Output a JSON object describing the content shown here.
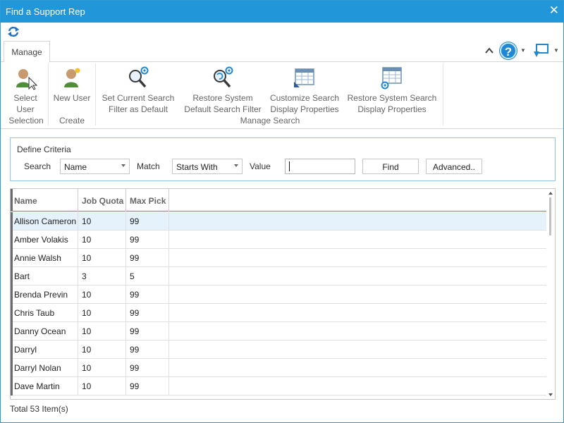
{
  "window": {
    "title": "Find a Support Rep"
  },
  "ribbon": {
    "tab": "Manage",
    "buttons": {
      "select_user": [
        "Select",
        "User"
      ],
      "new_user": [
        "New User"
      ],
      "set_default": [
        "Set Current Search",
        "Filter as Default"
      ],
      "restore_default": [
        "Restore System",
        "Default Search Filter"
      ],
      "customize_display": [
        "Customize Search",
        "Display Properties"
      ],
      "restore_display": [
        "Restore System Search",
        "Display Properties"
      ]
    },
    "groups": {
      "selection": "Selection",
      "create": "Create",
      "manage_search": "Manage Search"
    }
  },
  "criteria": {
    "legend": "Define Criteria",
    "search_label": "Search",
    "search_value": "Name",
    "match_label": "Match",
    "match_value": "Starts With",
    "value_label": "Value",
    "value_text": "",
    "find_label": "Find",
    "advanced_label": "Advanced.."
  },
  "grid": {
    "columns": [
      "Name",
      "Job Quota",
      "Max Pick"
    ],
    "rows": [
      [
        "Allison Cameron",
        "10",
        "99"
      ],
      [
        "Amber Volakis",
        "10",
        "99"
      ],
      [
        "Annie Walsh",
        "10",
        "99"
      ],
      [
        "Bart",
        "3",
        "5"
      ],
      [
        "Brenda Previn",
        "10",
        "99"
      ],
      [
        "Chris Taub",
        "10",
        "99"
      ],
      [
        "Danny Ocean",
        "10",
        "99"
      ],
      [
        "Darryl",
        "10",
        "99"
      ],
      [
        "Darryl Nolan",
        "10",
        "99"
      ],
      [
        "Dave Martin",
        "10",
        "99"
      ]
    ]
  },
  "footer": {
    "total": "Total 53 Item(s)"
  },
  "icons": {
    "refresh": "refresh-icon",
    "collapse": "chevron-up-icon",
    "help": "help-icon",
    "comment": "comment-icon"
  },
  "colors": {
    "accent": "#2196d9",
    "selected_row": "#e5f1fb"
  }
}
